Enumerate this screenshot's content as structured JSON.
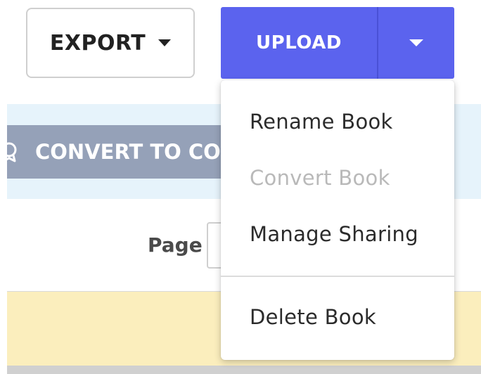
{
  "toolbar": {
    "export_label": "EXPORT",
    "upload_label": "UPLOAD"
  },
  "banner": {
    "convert_label": "CONVERT TO CO"
  },
  "pager": {
    "page_label": "Page"
  },
  "menu": {
    "items": [
      {
        "label": "Rename Book",
        "enabled": true
      },
      {
        "label": "Convert Book",
        "enabled": false
      },
      {
        "label": "Manage Sharing",
        "enabled": true
      },
      {
        "label": "Delete Book",
        "enabled": true
      }
    ]
  },
  "colors": {
    "upload_button": "#5b63ee",
    "convert_button": "#95a1b8",
    "info_band": "#e6f3fb",
    "notice_band": "#fbeebd",
    "disabled_text": "#b9b9b9"
  }
}
